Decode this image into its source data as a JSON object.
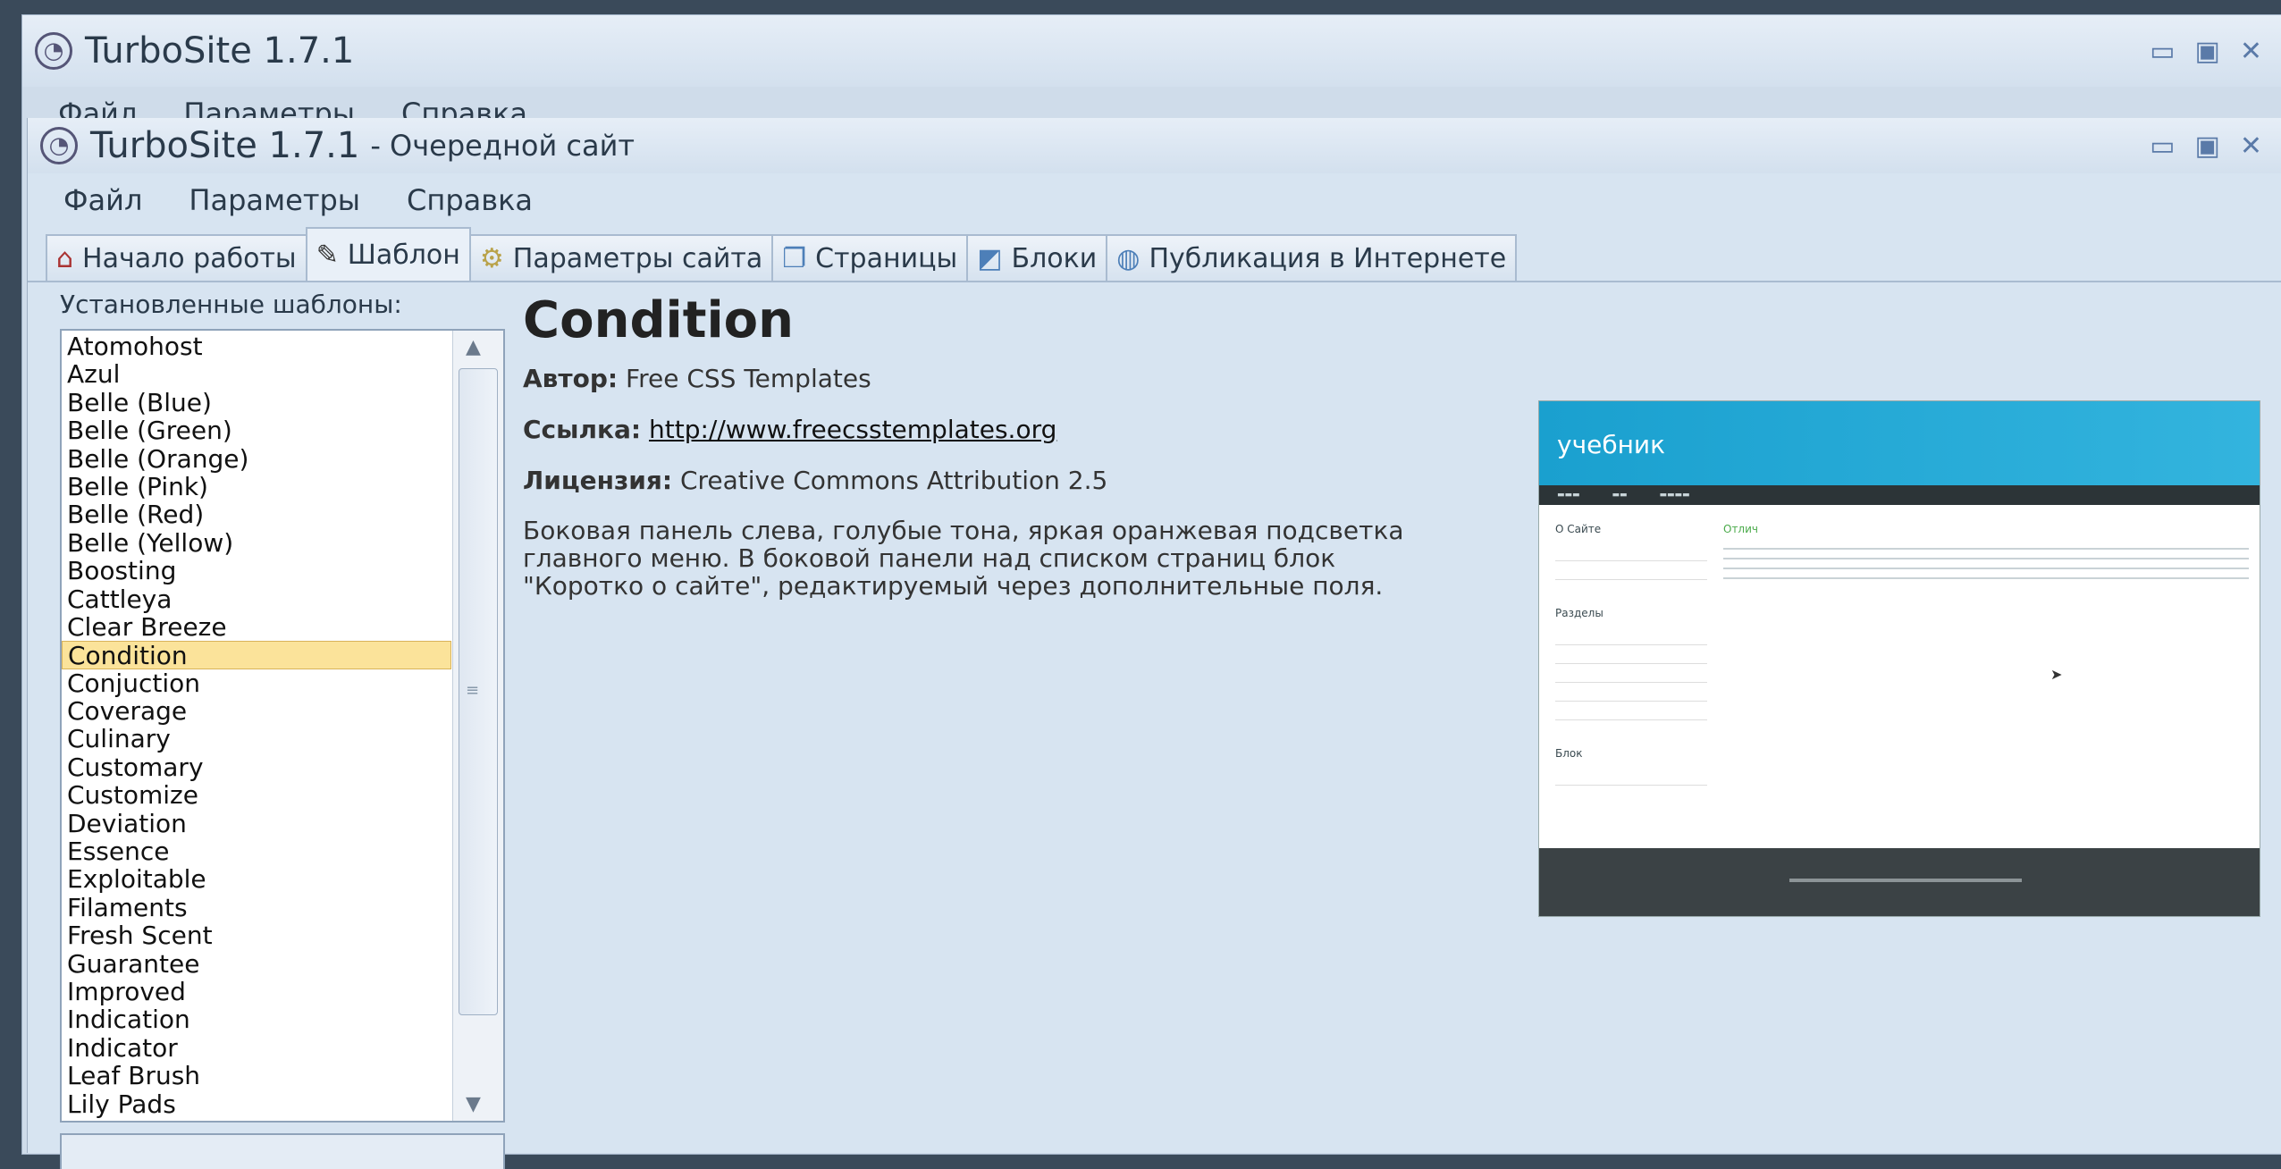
{
  "bg_window": {
    "title": "TurboSite 1.7.1",
    "menu": [
      "Файл",
      "Параметры",
      "Справка"
    ]
  },
  "window": {
    "title": "TurboSite 1.7.1",
    "subtitle": "- Очередной сайт",
    "controls": [
      "minimize",
      "maximize",
      "close"
    ],
    "menu": [
      "Файл",
      "Параметры",
      "Справка"
    ]
  },
  "tabs": [
    {
      "label": "Начало работы",
      "icon": "home-icon"
    },
    {
      "label": "Шаблон",
      "icon": "brush-icon",
      "active": true
    },
    {
      "label": "Параметры сайта",
      "icon": "gear-icon"
    },
    {
      "label": "Страницы",
      "icon": "pages-icon"
    },
    {
      "label": "Блоки",
      "icon": "blocks-icon"
    },
    {
      "label": "Публикация в Интернете",
      "icon": "globe-icon"
    }
  ],
  "templates": {
    "label": "Установленные шаблоны:",
    "selected": "Condition",
    "items": [
      "Atomohost",
      "Azul",
      "Belle (Blue)",
      "Belle (Green)",
      "Belle (Orange)",
      "Belle (Pink)",
      "Belle (Red)",
      "Belle (Yellow)",
      "Boosting",
      "Cattleya",
      "Clear Breeze",
      "Condition",
      "Conjuction",
      "Coverage",
      "Culinary",
      "Customary",
      "Customize",
      "Deviation",
      "Essence",
      "Exploitable",
      "Filaments",
      "Fresh Scent",
      "Guarantee",
      "Improved",
      "Indication",
      "Indicator",
      "Leaf Brush",
      "Lily Pads"
    ]
  },
  "details": {
    "name": "Condition",
    "author_label": "Автор:",
    "author": "Free CSS Templates",
    "link_label": "Ссылка:",
    "link": "http://www.freecsstemplates.org",
    "license_label": "Лицензия:",
    "license": "Creative Commons Attribution 2.5",
    "description": "Боковая панель слева, голубые тона, яркая оранжевая подсветка главного меню. В боковой панели над списком страниц блок \"Коротко о сайте\", редактируемый через дополнительные поля."
  },
  "preview": {
    "site_title": "учебник",
    "side_heading_1": "О Сайте",
    "side_heading_2": "Разделы",
    "side_heading_3": "Блок",
    "main_heading": "Отлич"
  },
  "colors": {
    "selection": "#fbe39a",
    "preview_header": "#1aa0cf",
    "window_bg": "#d7e4f1"
  }
}
